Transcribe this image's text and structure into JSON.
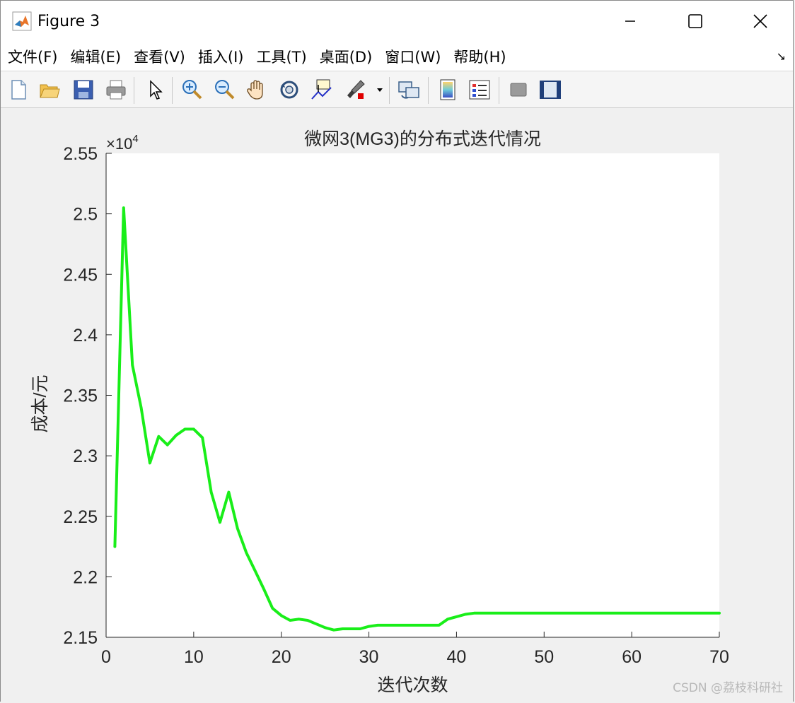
{
  "window": {
    "title": "Figure 3"
  },
  "menu": [
    "文件(F)",
    "编辑(E)",
    "查看(V)",
    "插入(I)",
    "工具(T)",
    "桌面(D)",
    "窗口(W)",
    "帮助(H)"
  ],
  "toolbar": {
    "icons": [
      "new-figure-icon",
      "open-file-icon",
      "save-icon",
      "print-icon",
      "select-arrow-icon",
      "zoom-in-icon",
      "zoom-out-icon",
      "pan-hand-icon",
      "rotate-3d-icon",
      "data-cursor-icon",
      "brush-icon",
      "link-plot-icon",
      "colorbar-icon",
      "legend-icon",
      "hide-plot-tools-icon",
      "show-plot-tools-icon"
    ]
  },
  "watermark": "CSDN @荔枝科研社",
  "colors": {
    "line": "#19ee19",
    "plot_bg": "#ffffff",
    "figure_bg": "#f0f0f0"
  },
  "chart_data": {
    "type": "line",
    "title": "微网3(MG3)的分布式迭代情况",
    "xlabel": "迭代次数",
    "ylabel": "成本/元",
    "exponent_label": "×10",
    "exponent_power": "4",
    "xlim": [
      0,
      70
    ],
    "ylim": [
      2.15,
      2.55
    ],
    "xticks": [
      "0",
      "10",
      "20",
      "30",
      "40",
      "50",
      "60",
      "70"
    ],
    "xtick_values": [
      0,
      10,
      20,
      30,
      40,
      50,
      60,
      70
    ],
    "yticks": [
      "2.15",
      "2.2",
      "2.25",
      "2.3",
      "2.35",
      "2.4",
      "2.45",
      "2.5",
      "2.55"
    ],
    "ytick_values": [
      2.15,
      2.2,
      2.25,
      2.3,
      2.35,
      2.4,
      2.45,
      2.5,
      2.55
    ],
    "series": [
      {
        "x": [
          1,
          2,
          3,
          4,
          5,
          6,
          7,
          8,
          9,
          10,
          11,
          12,
          13,
          14,
          15,
          16,
          17,
          18,
          19,
          20,
          21,
          22,
          23,
          24,
          25,
          26,
          27,
          28,
          29,
          30,
          31,
          32,
          33,
          34,
          35,
          36,
          37,
          38,
          39,
          40,
          41,
          42,
          43,
          44,
          45,
          46,
          47,
          48,
          49,
          50,
          55,
          60,
          65,
          70
        ],
        "y": [
          2.225,
          2.505,
          2.375,
          2.34,
          2.294,
          2.316,
          2.309,
          2.317,
          2.322,
          2.322,
          2.315,
          2.27,
          2.245,
          2.27,
          2.24,
          2.22,
          2.205,
          2.19,
          2.174,
          2.168,
          2.164,
          2.165,
          2.164,
          2.161,
          2.158,
          2.156,
          2.157,
          2.157,
          2.157,
          2.159,
          2.16,
          2.16,
          2.16,
          2.16,
          2.16,
          2.16,
          2.16,
          2.16,
          2.165,
          2.167,
          2.169,
          2.17,
          2.17,
          2.17,
          2.17,
          2.17,
          2.17,
          2.17,
          2.17,
          2.17,
          2.17,
          2.17,
          2.17,
          2.17
        ]
      }
    ],
    "grid": false,
    "legend": "none"
  }
}
